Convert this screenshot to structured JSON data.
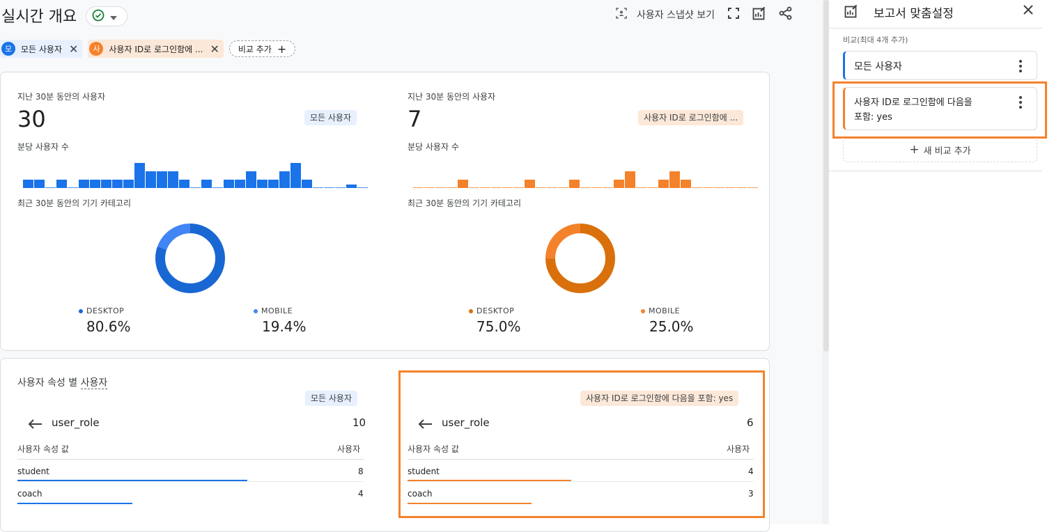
{
  "header": {
    "title": "실시간 개요",
    "snapshot_label": "사용자 스냅샷 보기"
  },
  "chips": {
    "all_users": {
      "avatar": "모",
      "label": "모든 사용자"
    },
    "logged_in": {
      "avatar": "사",
      "label": "사용자 ID로 로그인함에 ..."
    },
    "add_compare": "비교 추가"
  },
  "card_top": {
    "left": {
      "users_label": "지난 30분 동안의 사용자",
      "users_value": "30",
      "segment": "모든 사용자",
      "per_min_label": "분당 사용자 수",
      "device_label": "최근 30분 동안의 기기 카테고리",
      "desktop_label": "DESKTOP",
      "desktop_pct": "80.6%",
      "mobile_label": "MOBILE",
      "mobile_pct": "19.4%"
    },
    "right": {
      "users_label": "지난 30분 동안의 사용자",
      "users_value": "7",
      "segment": "사용자 ID로 로그인함에 ...",
      "per_min_label": "분당 사용자 수",
      "device_label": "최근 30분 동안의 기기 카테고리",
      "desktop_label": "DESKTOP",
      "desktop_pct": "75.0%",
      "mobile_label": "MOBILE",
      "mobile_pct": "25.0%"
    }
  },
  "chart_data": [
    {
      "type": "bar",
      "title": "분당 사용자 수",
      "color": "#1a73e8",
      "values": [
        1,
        1,
        0,
        1,
        0,
        1,
        1,
        1,
        1,
        1,
        3,
        2,
        2,
        2,
        1,
        0,
        1,
        0,
        1,
        1,
        2,
        1,
        1,
        2,
        3,
        1,
        0,
        0,
        0,
        0.4,
        0
      ]
    },
    {
      "type": "bar",
      "title": "분당 사용자 수",
      "color": "#f4822b",
      "values": [
        0,
        0,
        0,
        0,
        1,
        0,
        0,
        0,
        0,
        0,
        1,
        0,
        0,
        0,
        1,
        0,
        0,
        0,
        1,
        2,
        0,
        0,
        1,
        2,
        1,
        0,
        0,
        0,
        0,
        0,
        0
      ]
    },
    {
      "type": "pie",
      "title": "최근 30분 동안의 기기 카테고리",
      "categories": [
        "DESKTOP",
        "MOBILE"
      ],
      "values": [
        80.6,
        19.4
      ],
      "colors": [
        "#1967d2",
        "#4285f4"
      ]
    },
    {
      "type": "pie",
      "title": "최근 30분 동안의 기기 카테고리",
      "categories": [
        "DESKTOP",
        "MOBILE"
      ],
      "values": [
        75.0,
        25.0
      ],
      "colors": [
        "#d9700b",
        "#f4822b"
      ]
    }
  ],
  "card_bottom": {
    "title": "사용자 속성 별",
    "title_link": "사용자",
    "left": {
      "segment": "모든 사용자",
      "dimension": "user_role",
      "total": "10",
      "col_value": "사용자 속성 값",
      "col_users": "사용자",
      "rows": [
        {
          "label": "student",
          "value": "8",
          "fraction": 0.8
        },
        {
          "label": "coach",
          "value": "4",
          "fraction": 0.4
        }
      ]
    },
    "right": {
      "segment": "사용자 ID로 로그인함에 다음을 포함: yes",
      "dimension": "user_role",
      "total": "6",
      "col_value": "사용자 속성 값",
      "col_users": "사용자",
      "rows": [
        {
          "label": "student",
          "value": "4",
          "fraction": 0.57
        },
        {
          "label": "coach",
          "value": "3",
          "fraction": 0.43
        }
      ]
    }
  },
  "sidebar": {
    "title": "보고서 맞춤설정",
    "compare_hint": "비교(최대 4개 추가)",
    "item1": "모든 사용자",
    "item2_line1": "사용자 ID로 로그인함에 다음을",
    "item2_line2": "포함: yes",
    "add_new": "새 비교 추가"
  },
  "colors": {
    "blue": "#1a73e8",
    "orange": "#f4822b",
    "highlight": "#f4822b"
  }
}
